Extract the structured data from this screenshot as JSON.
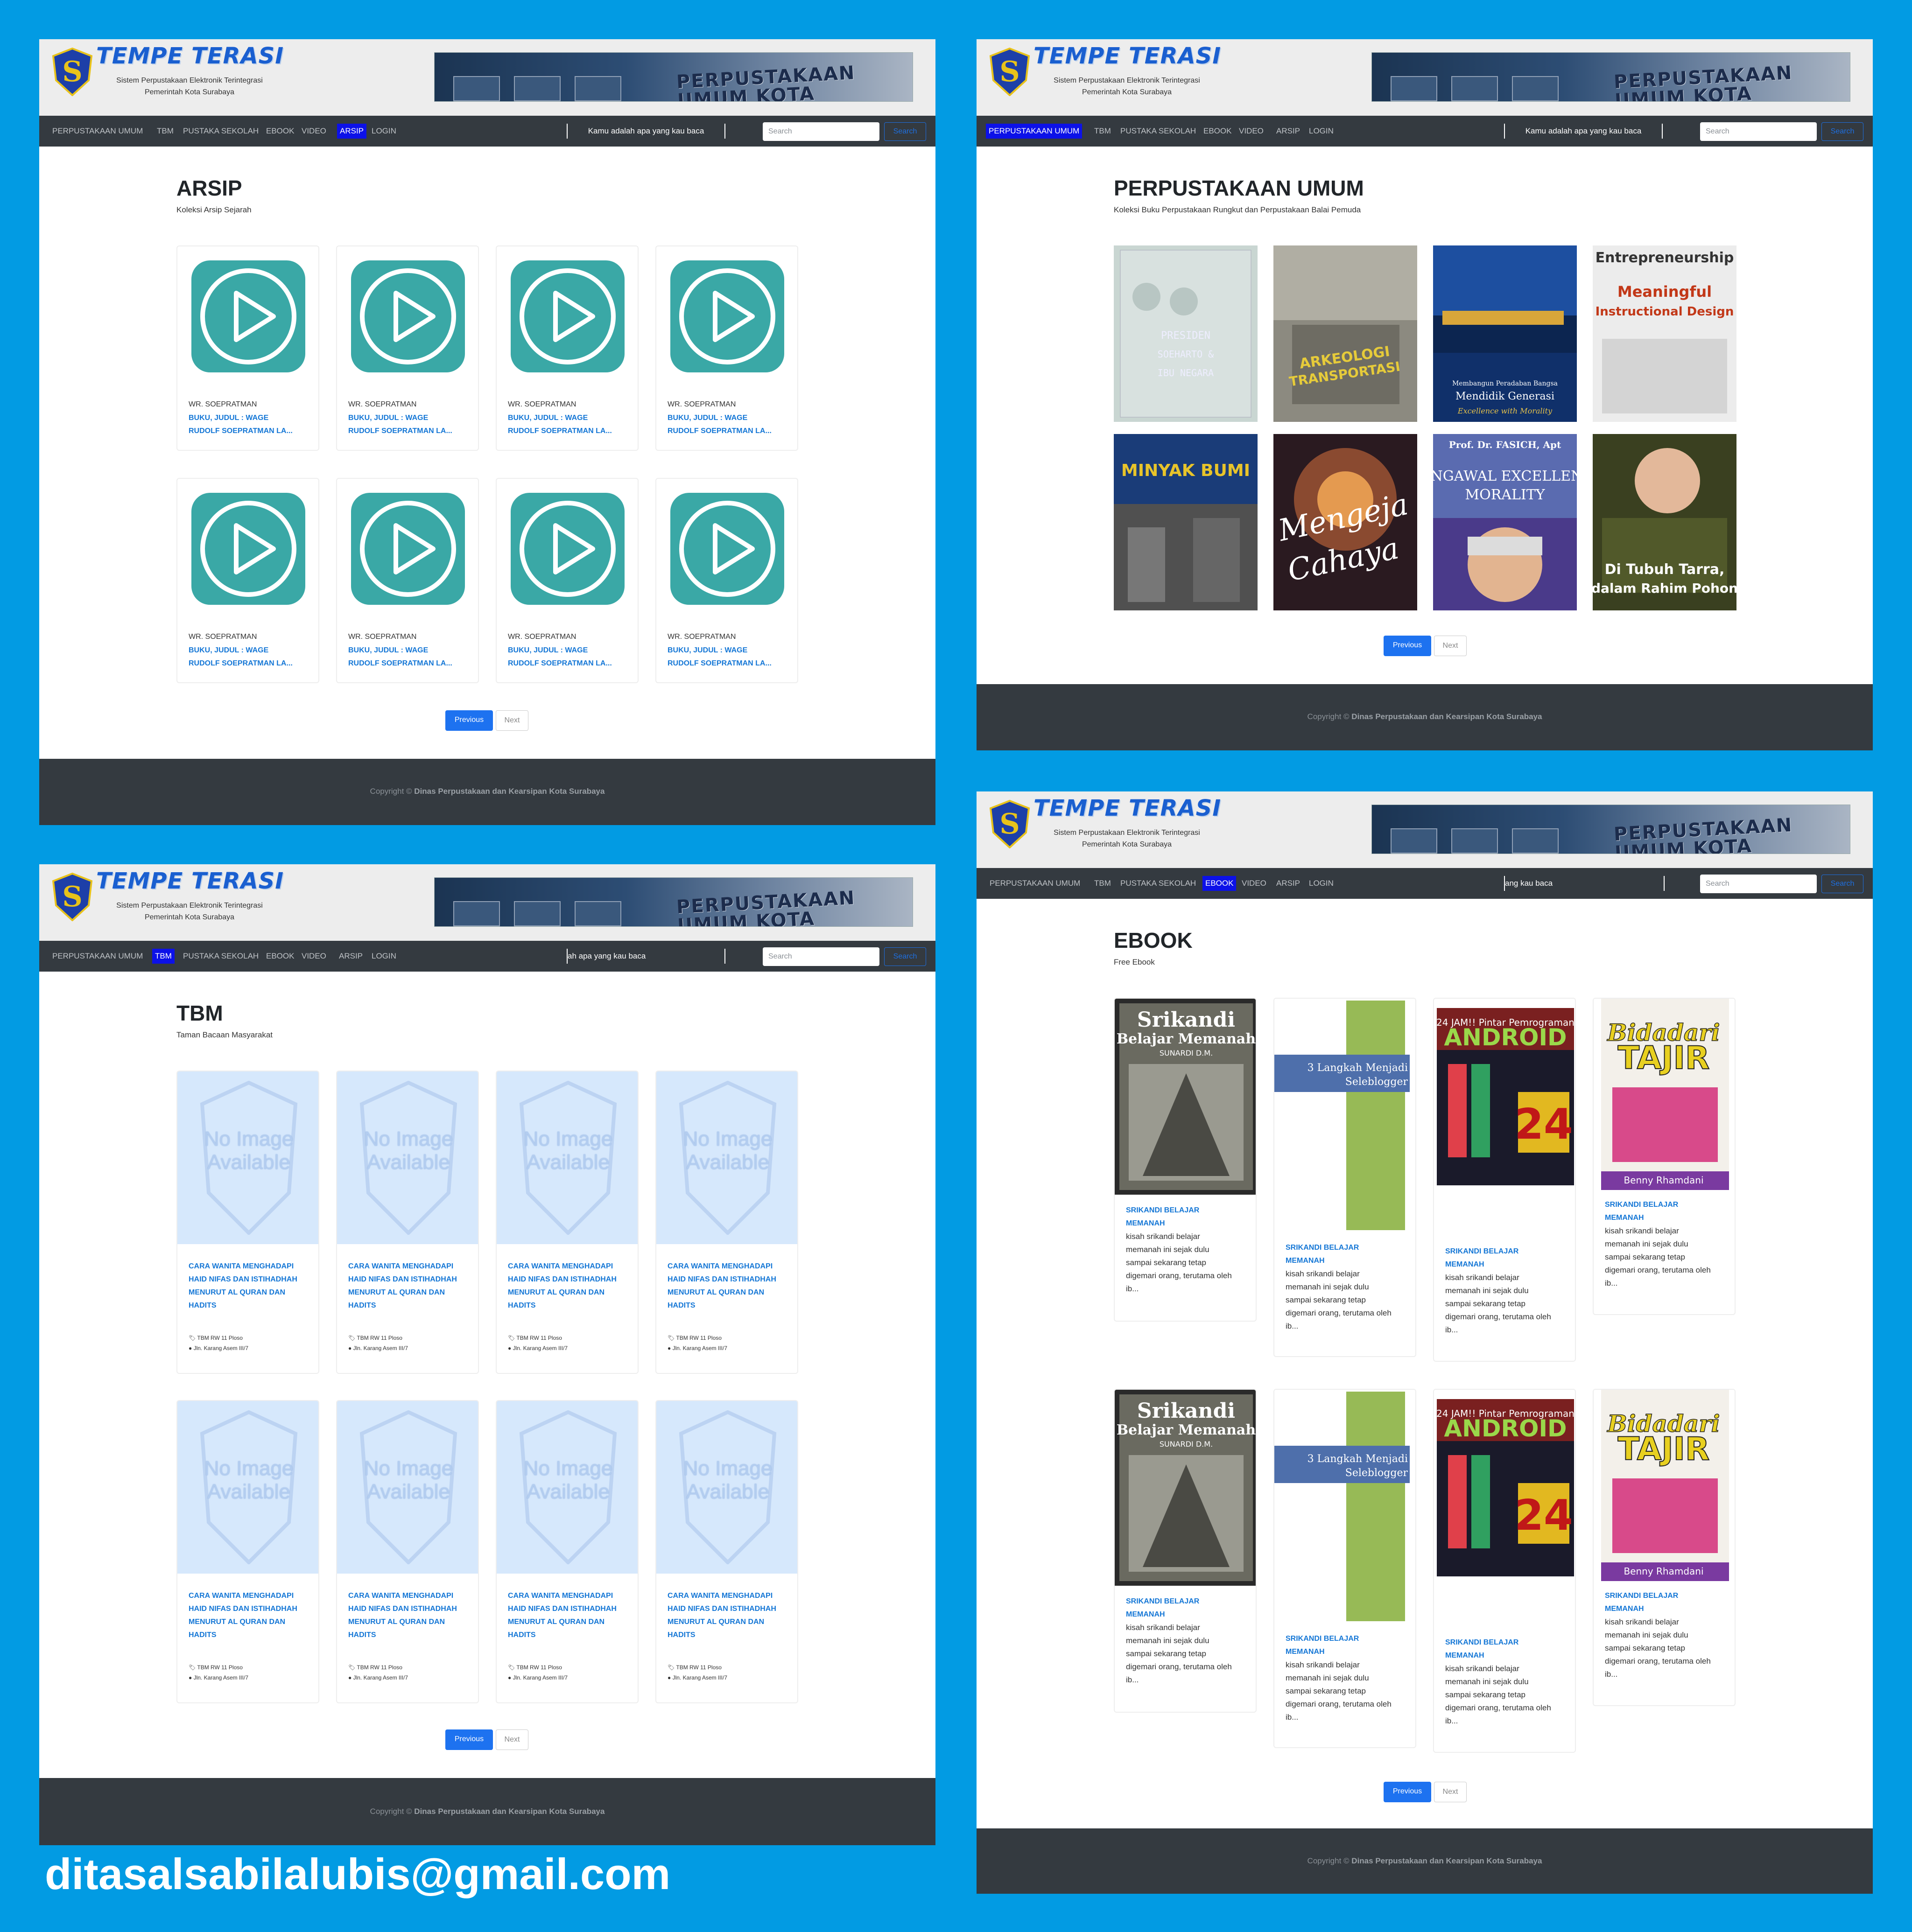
{
  "app": {
    "brand": "TEMPE TERASI",
    "subtitle_1": "Sistem Perpustakaan Elektronik Terintegrasi",
    "subtitle_2": "Pemerintah Kota Surabaya",
    "banner_text": "PERPUSTAKAAN UMUM KOTA SURABAYA"
  },
  "nav": {
    "items": [
      "PERPUSTAKAAN UMUM",
      "TBM",
      "PUSTAKA SEKOLAH",
      "EBOOK",
      "VIDEO",
      "ARSIP",
      "LOGIN"
    ],
    "quote": "Kamu adalah apa yang kau baca",
    "quote_tbm": "ah apa yang kau baca",
    "quote_ebook": "ang kau baca",
    "search_placeholder": "Search",
    "search_button": "Search"
  },
  "arsip": {
    "title": "ARSIP",
    "desc": "Koleksi Arsip Sejarah",
    "card_author": "WR. SOEPRATMAN",
    "card_title_1": "BUKU, JUDUL : WAGE",
    "card_title_2": "RUDOLF SOEPRATMAN LA..."
  },
  "umum": {
    "title": "PERPUSTAKAAN UMUM",
    "desc": "Koleksi Buku Perpustakaan Rungkut dan Perpustakaan Balai Pemuda",
    "books": [
      {
        "t1": "PRESIDEN",
        "t2": "SOEHARTO &",
        "t3": "IBU NEGARA"
      },
      {
        "t1": "ARKEOLOGI",
        "t2": "TRANSPORTASI",
        "t3": ""
      },
      {
        "t1": "Membangun Peradaban Bangsa",
        "t2": "Mendidik Generasi",
        "t3": "Excellence with Morality"
      },
      {
        "t1": "Entrepreneurship",
        "t2": "Meaningful",
        "t3": "Instructional Design"
      },
      {
        "t1": "MINYAK BUMI",
        "t2": "",
        "t3": ""
      },
      {
        "t1": "Mengeja",
        "t2": "Cahaya",
        "t3": ""
      },
      {
        "t1": "Prof. Dr. FASICH, Apt",
        "t2": "MENGAWAL EXCELLENCE",
        "t3": "MORALITY"
      },
      {
        "t1": "Di Tubuh Tarra,",
        "t2": "dalam Rahim Pohon",
        "t3": ""
      }
    ]
  },
  "tbm": {
    "title": "TBM",
    "desc": "Taman Bacaan Masyarakat",
    "noimg_1": "No Image",
    "noimg_2": "Available",
    "card_title": "CARA WANITA MENGHADAPI HAID NIFAS DAN ISTIHADHAH MENURUT AL QURAN DAN HADITS",
    "tag": "TBM RW 11 Ploso",
    "address": "Jln. Karang Asem III/7"
  },
  "ebook": {
    "title": "EBOOK",
    "desc": "Free Ebook",
    "card_title_1": "SRIKANDI BELAJAR",
    "card_title_2": "MEMANAH",
    "card_text": "kisah srikandi belajar memanah ini sejak dulu sampai sekarang tetap digemari orang, terutama oleh ib...",
    "covers": [
      {
        "t1": "Srikandi",
        "t2": "Belajar Memanah",
        "t3": "SUNARDI D.M."
      },
      {
        "t1": "3 Langkah Menjadi",
        "t2": "Seleblogger",
        "t3": ""
      },
      {
        "t1": "24 JAM!! Pintar Pemrograman",
        "t2": "ANDROID",
        "t3": "24"
      },
      {
        "t1": "Bidadari",
        "t2": "TAJIR",
        "t3": "Benny Rhamdani"
      }
    ]
  },
  "pagination": {
    "prev": "Previous",
    "next": "Next"
  },
  "footer": {
    "prefix": "Copyright ©",
    "org": "Dinas Perpustakaan dan Kearsipan Kota Surabaya"
  },
  "email": "ditasalsabilalubis@gmail.com",
  "colors": {
    "accent": "#1d72f0",
    "nav_active": "#0c11e8",
    "play": "#3aa8a6",
    "footer": "#343a40",
    "bg": "#029be3"
  }
}
